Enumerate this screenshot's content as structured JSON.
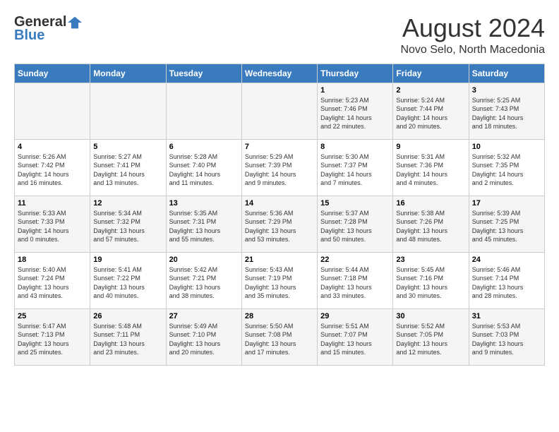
{
  "header": {
    "logo_general": "General",
    "logo_blue": "Blue",
    "title": "August 2024",
    "location": "Novo Selo, North Macedonia"
  },
  "calendar": {
    "days_of_week": [
      "Sunday",
      "Monday",
      "Tuesday",
      "Wednesday",
      "Thursday",
      "Friday",
      "Saturday"
    ],
    "weeks": [
      [
        {
          "day": "",
          "info": ""
        },
        {
          "day": "",
          "info": ""
        },
        {
          "day": "",
          "info": ""
        },
        {
          "day": "",
          "info": ""
        },
        {
          "day": "1",
          "info": "Sunrise: 5:23 AM\nSunset: 7:46 PM\nDaylight: 14 hours\nand 22 minutes."
        },
        {
          "day": "2",
          "info": "Sunrise: 5:24 AM\nSunset: 7:44 PM\nDaylight: 14 hours\nand 20 minutes."
        },
        {
          "day": "3",
          "info": "Sunrise: 5:25 AM\nSunset: 7:43 PM\nDaylight: 14 hours\nand 18 minutes."
        }
      ],
      [
        {
          "day": "4",
          "info": "Sunrise: 5:26 AM\nSunset: 7:42 PM\nDaylight: 14 hours\nand 16 minutes."
        },
        {
          "day": "5",
          "info": "Sunrise: 5:27 AM\nSunset: 7:41 PM\nDaylight: 14 hours\nand 13 minutes."
        },
        {
          "day": "6",
          "info": "Sunrise: 5:28 AM\nSunset: 7:40 PM\nDaylight: 14 hours\nand 11 minutes."
        },
        {
          "day": "7",
          "info": "Sunrise: 5:29 AM\nSunset: 7:39 PM\nDaylight: 14 hours\nand 9 minutes."
        },
        {
          "day": "8",
          "info": "Sunrise: 5:30 AM\nSunset: 7:37 PM\nDaylight: 14 hours\nand 7 minutes."
        },
        {
          "day": "9",
          "info": "Sunrise: 5:31 AM\nSunset: 7:36 PM\nDaylight: 14 hours\nand 4 minutes."
        },
        {
          "day": "10",
          "info": "Sunrise: 5:32 AM\nSunset: 7:35 PM\nDaylight: 14 hours\nand 2 minutes."
        }
      ],
      [
        {
          "day": "11",
          "info": "Sunrise: 5:33 AM\nSunset: 7:33 PM\nDaylight: 14 hours\nand 0 minutes."
        },
        {
          "day": "12",
          "info": "Sunrise: 5:34 AM\nSunset: 7:32 PM\nDaylight: 13 hours\nand 57 minutes."
        },
        {
          "day": "13",
          "info": "Sunrise: 5:35 AM\nSunset: 7:31 PM\nDaylight: 13 hours\nand 55 minutes."
        },
        {
          "day": "14",
          "info": "Sunrise: 5:36 AM\nSunset: 7:29 PM\nDaylight: 13 hours\nand 53 minutes."
        },
        {
          "day": "15",
          "info": "Sunrise: 5:37 AM\nSunset: 7:28 PM\nDaylight: 13 hours\nand 50 minutes."
        },
        {
          "day": "16",
          "info": "Sunrise: 5:38 AM\nSunset: 7:26 PM\nDaylight: 13 hours\nand 48 minutes."
        },
        {
          "day": "17",
          "info": "Sunrise: 5:39 AM\nSunset: 7:25 PM\nDaylight: 13 hours\nand 45 minutes."
        }
      ],
      [
        {
          "day": "18",
          "info": "Sunrise: 5:40 AM\nSunset: 7:24 PM\nDaylight: 13 hours\nand 43 minutes."
        },
        {
          "day": "19",
          "info": "Sunrise: 5:41 AM\nSunset: 7:22 PM\nDaylight: 13 hours\nand 40 minutes."
        },
        {
          "day": "20",
          "info": "Sunrise: 5:42 AM\nSunset: 7:21 PM\nDaylight: 13 hours\nand 38 minutes."
        },
        {
          "day": "21",
          "info": "Sunrise: 5:43 AM\nSunset: 7:19 PM\nDaylight: 13 hours\nand 35 minutes."
        },
        {
          "day": "22",
          "info": "Sunrise: 5:44 AM\nSunset: 7:18 PM\nDaylight: 13 hours\nand 33 minutes."
        },
        {
          "day": "23",
          "info": "Sunrise: 5:45 AM\nSunset: 7:16 PM\nDaylight: 13 hours\nand 30 minutes."
        },
        {
          "day": "24",
          "info": "Sunrise: 5:46 AM\nSunset: 7:14 PM\nDaylight: 13 hours\nand 28 minutes."
        }
      ],
      [
        {
          "day": "25",
          "info": "Sunrise: 5:47 AM\nSunset: 7:13 PM\nDaylight: 13 hours\nand 25 minutes."
        },
        {
          "day": "26",
          "info": "Sunrise: 5:48 AM\nSunset: 7:11 PM\nDaylight: 13 hours\nand 23 minutes."
        },
        {
          "day": "27",
          "info": "Sunrise: 5:49 AM\nSunset: 7:10 PM\nDaylight: 13 hours\nand 20 minutes."
        },
        {
          "day": "28",
          "info": "Sunrise: 5:50 AM\nSunset: 7:08 PM\nDaylight: 13 hours\nand 17 minutes."
        },
        {
          "day": "29",
          "info": "Sunrise: 5:51 AM\nSunset: 7:07 PM\nDaylight: 13 hours\nand 15 minutes."
        },
        {
          "day": "30",
          "info": "Sunrise: 5:52 AM\nSunset: 7:05 PM\nDaylight: 13 hours\nand 12 minutes."
        },
        {
          "day": "31",
          "info": "Sunrise: 5:53 AM\nSunset: 7:03 PM\nDaylight: 13 hours\nand 9 minutes."
        }
      ]
    ]
  }
}
